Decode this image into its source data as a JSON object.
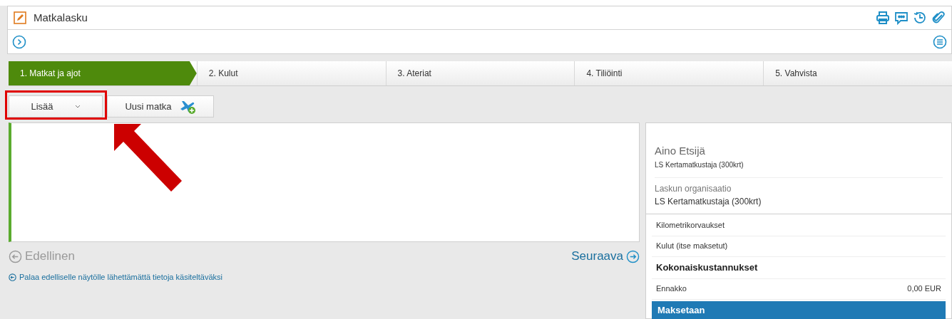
{
  "header": {
    "title": "Matkalasku"
  },
  "steps": [
    {
      "label": "1. Matkat ja ajot",
      "selected": true
    },
    {
      "label": "2. Kulut",
      "selected": false
    },
    {
      "label": "3. Ateriat",
      "selected": false
    },
    {
      "label": "4. Tiliöinti",
      "selected": false
    },
    {
      "label": "5. Vahvista",
      "selected": false
    }
  ],
  "toolbar": {
    "add_button": "Lisää",
    "new_trip_button": "Uusi matka",
    "highlight_add": true
  },
  "nav": {
    "previous": {
      "label": "Edellinen",
      "disabled": true
    },
    "next": {
      "label": "Seuraava",
      "disabled": false
    },
    "back_link": "Palaa edelliselle näytölle lähettämättä tietoja käsiteltäväksi"
  },
  "summary": {
    "person": {
      "name": "Aino Etsijä",
      "role": "LS Kertamatkustaja (300krt)"
    },
    "organisation": {
      "label": "Laskun organisaatio",
      "value": "LS Kertamatkustaja (300krt)"
    },
    "rows": [
      {
        "kind": "plain",
        "label": "Kilometrikorvaukset"
      },
      {
        "kind": "plain",
        "label": "Kulut (itse maksetut)"
      },
      {
        "kind": "bold",
        "label": "Kokonaiskustannukset"
      },
      {
        "kind": "plain",
        "label": "Ennakko",
        "value": "0,00 EUR"
      },
      {
        "kind": "total",
        "label": "Maksetaan"
      }
    ]
  }
}
